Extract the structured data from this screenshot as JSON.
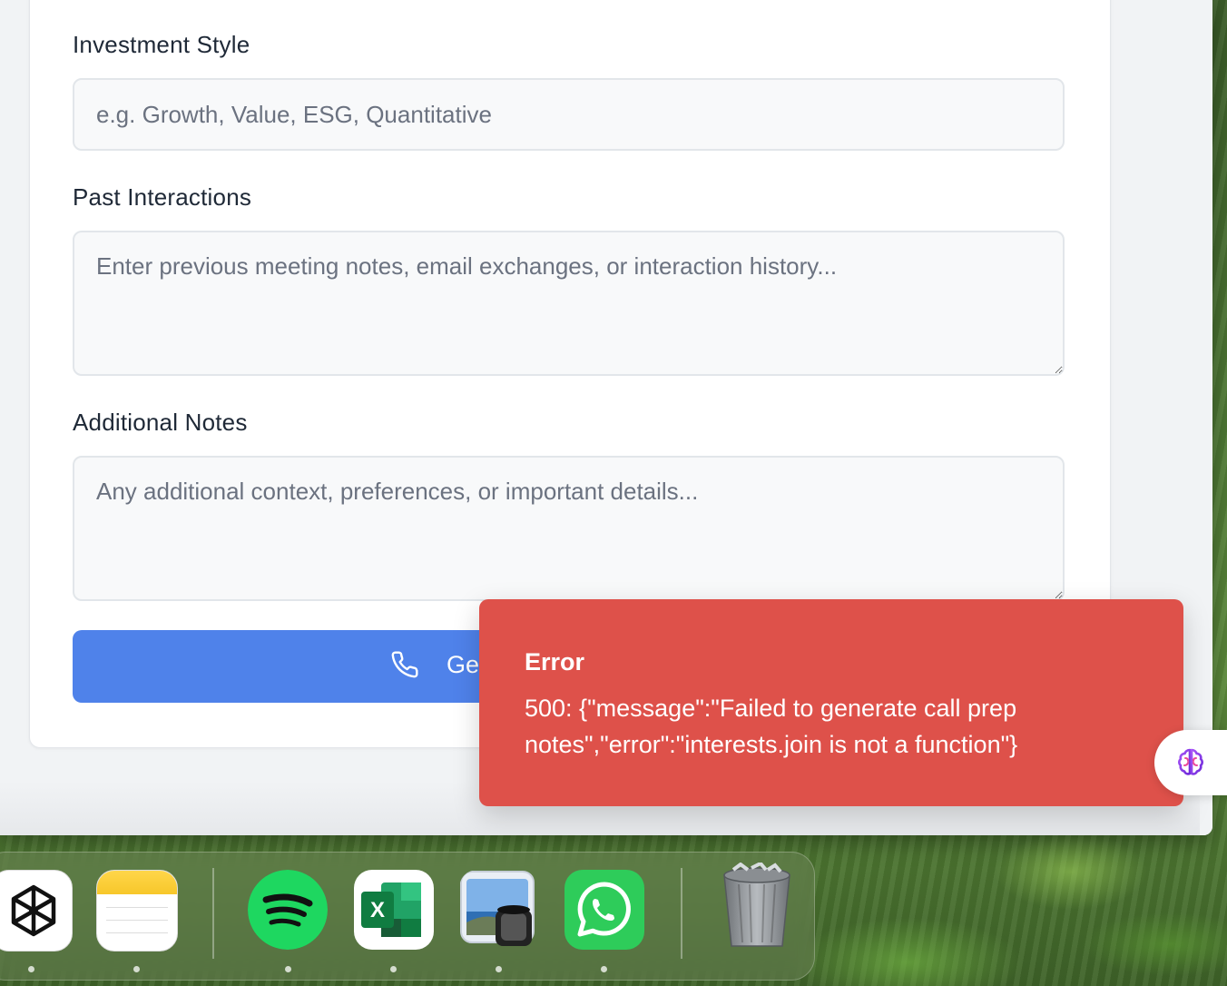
{
  "form": {
    "investment_style": {
      "label": "Investment Style",
      "placeholder": "e.g. Growth, Value, ESG, Quantitative",
      "value": ""
    },
    "past_interactions": {
      "label": "Past Interactions",
      "placeholder": "Enter previous meeting notes, email exchanges, or interaction history...",
      "value": ""
    },
    "additional_notes": {
      "label": "Additional Notes",
      "placeholder": "Any additional context, preferences, or important details...",
      "value": ""
    },
    "submit_button": {
      "label_visible": "Ge",
      "icon": "phone-icon"
    }
  },
  "toast": {
    "title": "Error",
    "message": "500: {\"message\":\"Failed to generate call prep notes\",\"error\":\"interests.join is not a function\"}",
    "color": "#de514a"
  },
  "assistant_button": {
    "icon": "brain-icon"
  },
  "dock": {
    "items": [
      {
        "name": "chatgpt",
        "icon": "openai-icon",
        "running": true
      },
      {
        "name": "notes",
        "icon": "notes-icon",
        "running": true
      },
      {
        "name": "spotify",
        "icon": "spotify-icon",
        "running": true
      },
      {
        "name": "excel",
        "icon": "excel-icon",
        "letter": "X",
        "running": true
      },
      {
        "name": "preview",
        "icon": "preview-icon",
        "running": true
      },
      {
        "name": "whatsapp",
        "icon": "whatsapp-icon",
        "running": true
      },
      {
        "name": "trash",
        "icon": "trash-icon",
        "running": false
      }
    ]
  },
  "colors": {
    "primary": "#4f82ea",
    "error": "#de514a",
    "field_bg": "#f8f9fa",
    "field_border": "#e2e6ea"
  }
}
